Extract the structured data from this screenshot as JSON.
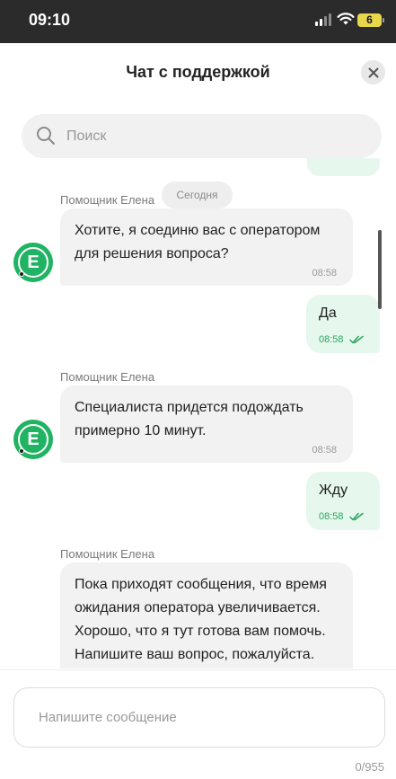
{
  "status_bar": {
    "time": "09:10",
    "battery": "6"
  },
  "header": {
    "title": "Чат с поддержкой"
  },
  "search": {
    "placeholder": "Поиск"
  },
  "chat": {
    "date_divider": "Сегодня",
    "messages": [
      {
        "direction": "in",
        "sender": "Помощник Елена",
        "text": "Хотите, я соединю вас с оператором для решения вопроса?",
        "time": "08:58",
        "avatar_letter": "E"
      },
      {
        "direction": "out",
        "text": "Да",
        "time": "08:58",
        "status": "read"
      },
      {
        "direction": "in",
        "sender": "Помощник Елена",
        "text": "Специалиста придется подождать примерно 10 минут.",
        "time": "08:58",
        "avatar_letter": "E"
      },
      {
        "direction": "out",
        "text": "Жду",
        "time": "08:58",
        "status": "read"
      },
      {
        "direction": "in",
        "sender": "Помощник Елена",
        "text": "Пока приходят сообщения, что время ожидания оператора увеличивается. Хорошо, что я тут готова вам помочь. Напишите ваш вопрос, пожалуйста."
      }
    ]
  },
  "composer": {
    "placeholder": "Напишите сообщение",
    "char_count": "0/955"
  },
  "colors": {
    "accent_green": "#20b363",
    "outgoing_bubble": "#e6f8ed",
    "incoming_bubble": "#f2f2f2"
  },
  "icons": [
    "signal-icon",
    "wifi-icon",
    "battery-icon",
    "close-icon",
    "search-icon",
    "double-check-icon"
  ]
}
